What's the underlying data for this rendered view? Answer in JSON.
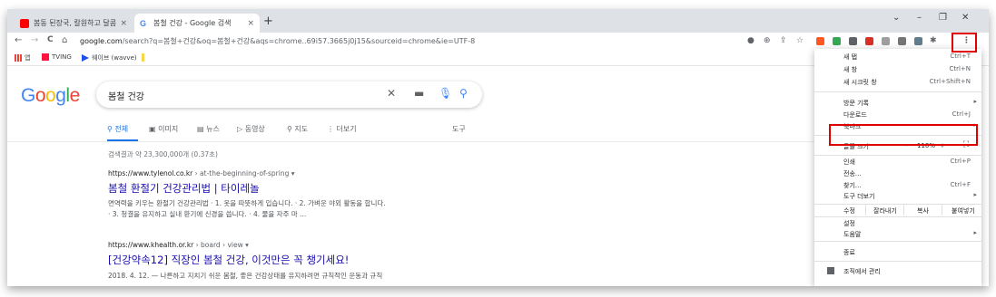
{
  "tabs": [
    {
      "title": "봄동 된장국, 칼원하고 달콤 구수",
      "close": "×"
    },
    {
      "title": "봄철 건강 - Google 검색",
      "close": "×"
    }
  ],
  "new_tab_label": "+",
  "window_controls": {
    "chevron": "⌄",
    "minimize": "–",
    "restore": "❐",
    "close": "✕"
  },
  "address": {
    "host": "google.com",
    "rest": "/search?q=봄철+건강&oq=봄철+건강&aqs=chrome..69i57.3665j0j15&sourceid=chrome&ie=UTF-8"
  },
  "nav": {
    "back": "←",
    "forward": "→",
    "reload": "C",
    "home": "⌂"
  },
  "bookmarks": [
    {
      "label": "앱"
    },
    {
      "label": "TVING"
    },
    {
      "label": "웨이브 (wavve)"
    }
  ],
  "logo": {
    "letters": [
      "G",
      "o",
      "o",
      "g",
      "l",
      "e"
    ],
    "colors": [
      "#4285f4",
      "#ea4335",
      "#fbbc05",
      "#4285f4",
      "#34a853",
      "#ea4335"
    ]
  },
  "search": {
    "query": "봄철 건강"
  },
  "search_tabs": {
    "all": "전체",
    "images": "이미지",
    "news": "뉴스",
    "videos": "동영상",
    "maps": "지도",
    "more": "더보기",
    "tools": "도구"
  },
  "stats": "검색결과 약 23,300,000개 (0.37초)",
  "results": [
    {
      "url_host": "https://www.tylenol.co.kr",
      "url_path": "› at-the-beginning-of-spring ▾",
      "title": "봄철 환절기 건강관리법 | 타이레놀",
      "snippet1": "면역력을 키우는 환절기 건강관리법 · 1. 옷을 따뜻하게 입습니다. · 2. 가벼운 야외 활동을 합니다.",
      "snippet2": "· 3. 청결을 유지하고 실내 환기에 신경을 씁니다. · 4. 물을 자주 마 ..."
    },
    {
      "url_host": "https://www.khealth.or.kr",
      "url_path": "› board › view ▾",
      "title": "[건강약속12] 직장인 봄철 건강, 이것만은 꼭 챙기세요!",
      "snippet1": "2018. 4. 12. — 나른하고 지치기 쉬운 봄철, 좋은 건강상태를 유지하려면 규칙적인 운동과 규칙"
    }
  ],
  "menu": {
    "new_tab": {
      "label": "새 탭",
      "shortcut": "Ctrl+T"
    },
    "new_window": {
      "label": "새 창",
      "shortcut": "Ctrl+N"
    },
    "incognito": {
      "label": "새 시크릿 창",
      "shortcut": "Ctrl+Shift+N"
    },
    "history": {
      "label": "방문 기록"
    },
    "downloads": {
      "label": "다운로드",
      "shortcut": "Ctrl+J"
    },
    "bookmarks": {
      "label": "북마크"
    },
    "zoom": {
      "label": "글꼴 크기",
      "minus": "−",
      "value": "110%",
      "plus": "+",
      "fullscreen": "⛶"
    },
    "print": {
      "label": "인쇄",
      "shortcut": "Ctrl+P"
    },
    "cast": {
      "label": "전송..."
    },
    "find": {
      "label": "찾기...",
      "shortcut": "Ctrl+F"
    },
    "more_tools": {
      "label": "도구 더보기"
    },
    "edit": {
      "label": "수정",
      "cut": "잘라내기",
      "copy": "복사",
      "paste": "붙여넣기"
    },
    "settings": {
      "label": "설정"
    },
    "help": {
      "label": "도움말"
    },
    "exit": {
      "label": "종료"
    },
    "managed": {
      "label": "조직에서 관리"
    }
  },
  "colors": {
    "accent": "#1a73e8",
    "link": "#1a0dab",
    "highlight": "#e00000"
  }
}
